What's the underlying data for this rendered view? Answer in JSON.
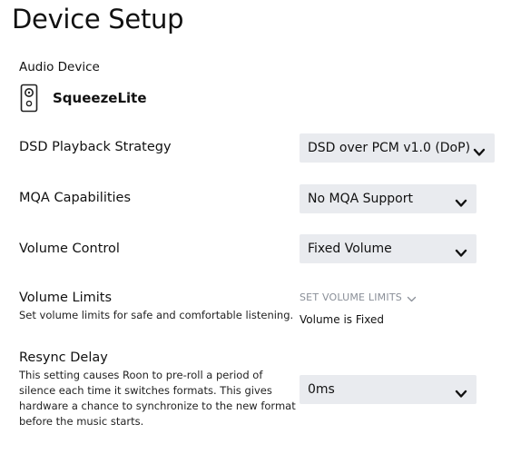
{
  "page": {
    "title": "Device Setup"
  },
  "audio_device": {
    "section_label": "Audio Device",
    "icon": "speaker-icon",
    "name": "SqueezeLite"
  },
  "settings": {
    "dsd": {
      "label": "DSD Playback Strategy",
      "value": "DSD over PCM v1.0 (DoP)"
    },
    "mqa": {
      "label": "MQA Capabilities",
      "value": "No MQA Support"
    },
    "volume_control": {
      "label": "Volume Control",
      "value": "Fixed Volume"
    },
    "volume_limits": {
      "label": "Volume Limits",
      "description": "Set volume limits for safe and comfortable listening.",
      "button_label": "SET VOLUME LIMITS",
      "note": "Volume is Fixed"
    },
    "resync_delay": {
      "label": "Resync Delay",
      "description_lines": [
        "This setting causes Roon to pre-roll a period of",
        "silence each time it switches formats. This gives",
        "hardware a chance to synchronize to the new format",
        "before the music starts."
      ],
      "value": "0ms"
    }
  },
  "icons": {
    "dropdown": "chevron-down-icon",
    "volume_limits_button": "chevron-down-icon"
  },
  "colors": {
    "dropdown_background": "#e9ebef",
    "muted_link": "#8a8f98"
  }
}
